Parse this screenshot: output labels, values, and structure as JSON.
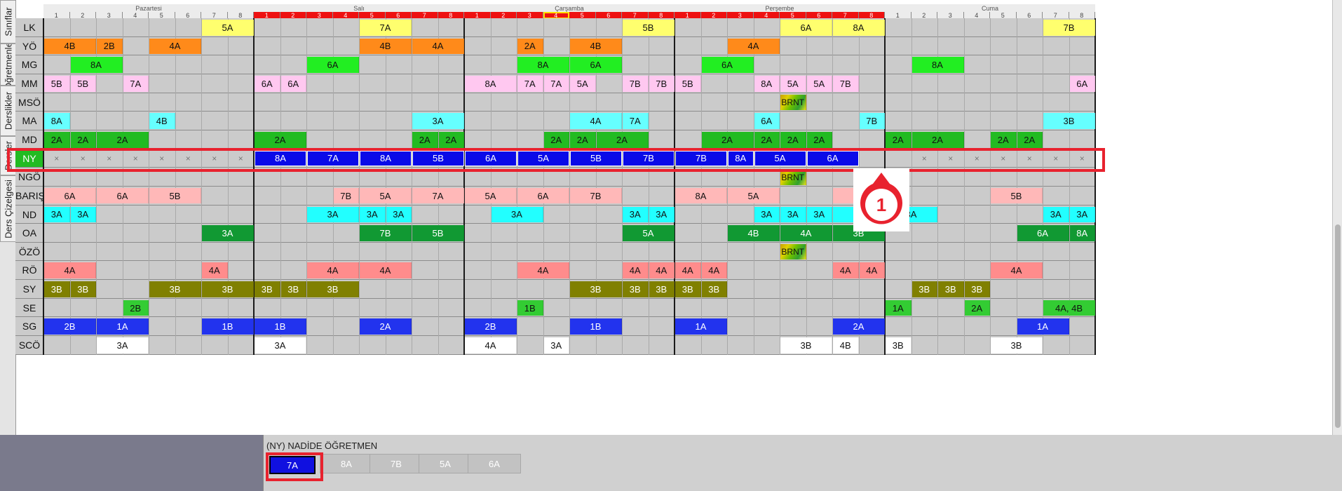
{
  "side_tabs": [
    "Sınıflar",
    "Öğretmenler",
    "Derslikler",
    "Dersler",
    "Ders Çizelgesi"
  ],
  "days": [
    "Pazartesi",
    "Salı",
    "Çarşamba",
    "Perşembe",
    "Cuma"
  ],
  "slot_numbers": [
    "1",
    "2",
    "3",
    "4",
    "5",
    "6",
    "7",
    "8"
  ],
  "conflict_color": "#ee1111",
  "conflict_days": [
    1,
    2,
    3
  ],
  "current_slot": {
    "day": 2,
    "slot": 3
  },
  "teachers": [
    "LK",
    "YÖ",
    "MG",
    "MM",
    "MSÖ",
    "MA",
    "MD",
    "NY",
    "NGÖ",
    "BARIŞ",
    "ND",
    "OA",
    "ÖZÖ",
    "RÖ",
    "SY",
    "SE",
    "SG",
    "SCÖ"
  ],
  "selected_teacher": "NY",
  "palette": {
    "LK": "#ffff6e",
    "YÖ": "#ff8a1a",
    "MG": "#22ee22",
    "MM": "#ffc8f0",
    "MA": "#66ffff",
    "MD": "#22bb22",
    "NY": "#0a0ae8",
    "BARIŞ": "#ffb8b8",
    "ND": "#22ffff",
    "OA": "#119933",
    "RÖ": "#ff8c8c",
    "SY": "#808000",
    "SE": "#33cc33",
    "SG": "#2233ee",
    "SCÖ": "#ffffff"
  },
  "lessons": [
    {
      "t": "LK",
      "d": 0,
      "s": 6,
      "w": 2,
      "label": "5A"
    },
    {
      "t": "LK",
      "d": 1,
      "s": 4,
      "w": 2,
      "label": "7A"
    },
    {
      "t": "LK",
      "d": 2,
      "s": 6,
      "w": 2,
      "label": "5B"
    },
    {
      "t": "LK",
      "d": 3,
      "s": 4,
      "w": 2,
      "label": "6A"
    },
    {
      "t": "LK",
      "d": 3,
      "s": 6,
      "w": 2,
      "label": "8A"
    },
    {
      "t": "LK",
      "d": 4,
      "s": 6,
      "w": 2,
      "label": "7B"
    },
    {
      "t": "YÖ",
      "d": 0,
      "s": 0,
      "w": 2,
      "label": "4B"
    },
    {
      "t": "YÖ",
      "d": 0,
      "s": 2,
      "w": 1,
      "label": "2B"
    },
    {
      "t": "YÖ",
      "d": 0,
      "s": 4,
      "w": 2,
      "label": "4A"
    },
    {
      "t": "YÖ",
      "d": 1,
      "s": 4,
      "w": 2,
      "label": "4B"
    },
    {
      "t": "YÖ",
      "d": 1,
      "s": 6,
      "w": 2,
      "label": "4A"
    },
    {
      "t": "YÖ",
      "d": 2,
      "s": 2,
      "w": 1,
      "label": "2A"
    },
    {
      "t": "YÖ",
      "d": 2,
      "s": 4,
      "w": 2,
      "label": "4B"
    },
    {
      "t": "YÖ",
      "d": 3,
      "s": 2,
      "w": 2,
      "label": "4A"
    },
    {
      "t": "MG",
      "d": 0,
      "s": 1,
      "w": 2,
      "label": "8A"
    },
    {
      "t": "MG",
      "d": 1,
      "s": 2,
      "w": 2,
      "label": "6A"
    },
    {
      "t": "MG",
      "d": 2,
      "s": 2,
      "w": 2,
      "label": "8A"
    },
    {
      "t": "MG",
      "d": 2,
      "s": 4,
      "w": 2,
      "label": "6A"
    },
    {
      "t": "MG",
      "d": 3,
      "s": 1,
      "w": 2,
      "label": "6A"
    },
    {
      "t": "MG",
      "d": 4,
      "s": 1,
      "w": 2,
      "label": "8A"
    },
    {
      "t": "MM",
      "d": 0,
      "s": 0,
      "w": 1,
      "label": "5B"
    },
    {
      "t": "MM",
      "d": 0,
      "s": 1,
      "w": 1,
      "label": "5B"
    },
    {
      "t": "MM",
      "d": 0,
      "s": 3,
      "w": 1,
      "label": "7A"
    },
    {
      "t": "MM",
      "d": 1,
      "s": 0,
      "w": 1,
      "label": "6A"
    },
    {
      "t": "MM",
      "d": 1,
      "s": 1,
      "w": 1,
      "label": "6A"
    },
    {
      "t": "MM",
      "d": 2,
      "s": 0,
      "w": 2,
      "label": "8A"
    },
    {
      "t": "MM",
      "d": 2,
      "s": 2,
      "w": 1,
      "label": "7A"
    },
    {
      "t": "MM",
      "d": 2,
      "s": 3,
      "w": 1,
      "label": "7A"
    },
    {
      "t": "MM",
      "d": 2,
      "s": 4,
      "w": 1,
      "label": "5A"
    },
    {
      "t": "MM",
      "d": 2,
      "s": 6,
      "w": 1,
      "label": "7B"
    },
    {
      "t": "MM",
      "d": 2,
      "s": 7,
      "w": 1,
      "label": "7B"
    },
    {
      "t": "MM",
      "d": 3,
      "s": 0,
      "w": 1,
      "label": "5B"
    },
    {
      "t": "MM",
      "d": 3,
      "s": 3,
      "w": 1,
      "label": "8A"
    },
    {
      "t": "MM",
      "d": 3,
      "s": 4,
      "w": 1,
      "label": "5A"
    },
    {
      "t": "MM",
      "d": 3,
      "s": 5,
      "w": 1,
      "label": "5A"
    },
    {
      "t": "MM",
      "d": 3,
      "s": 6,
      "w": 1,
      "label": "7B"
    },
    {
      "t": "MM",
      "d": 4,
      "s": 7,
      "w": 1,
      "label": "6A"
    },
    {
      "t": "MSÖ",
      "d": 3,
      "s": 4,
      "w": 1,
      "label": "BRNT",
      "brnt": true
    },
    {
      "t": "MA",
      "d": 0,
      "s": 0,
      "w": 1,
      "label": "8A"
    },
    {
      "t": "MA",
      "d": 0,
      "s": 4,
      "w": 1,
      "label": "4B"
    },
    {
      "t": "MA",
      "d": 1,
      "s": 6,
      "w": 2,
      "label": "3A"
    },
    {
      "t": "MA",
      "d": 2,
      "s": 4,
      "w": 2,
      "label": "4A"
    },
    {
      "t": "MA",
      "d": 2,
      "s": 6,
      "w": 1,
      "label": "7A"
    },
    {
      "t": "MA",
      "d": 3,
      "s": 3,
      "w": 1,
      "label": "6A"
    },
    {
      "t": "MA",
      "d": 3,
      "s": 7,
      "w": 1,
      "label": "7B"
    },
    {
      "t": "MA",
      "d": 4,
      "s": 6,
      "w": 2,
      "label": "3B"
    },
    {
      "t": "MD",
      "d": 0,
      "s": 0,
      "w": 1,
      "label": "2A"
    },
    {
      "t": "MD",
      "d": 0,
      "s": 1,
      "w": 1,
      "label": "2A"
    },
    {
      "t": "MD",
      "d": 0,
      "s": 2,
      "w": 2,
      "label": "2A"
    },
    {
      "t": "MD",
      "d": 1,
      "s": 0,
      "w": 2,
      "label": "2A"
    },
    {
      "t": "MD",
      "d": 1,
      "s": 6,
      "w": 1,
      "label": "2A"
    },
    {
      "t": "MD",
      "d": 1,
      "s": 7,
      "w": 1,
      "label": "2A"
    },
    {
      "t": "MD",
      "d": 2,
      "s": 3,
      "w": 1,
      "label": "2A"
    },
    {
      "t": "MD",
      "d": 2,
      "s": 4,
      "w": 1,
      "label": "2A"
    },
    {
      "t": "MD",
      "d": 2,
      "s": 5,
      "w": 2,
      "label": "2A"
    },
    {
      "t": "MD",
      "d": 3,
      "s": 1,
      "w": 2,
      "label": "2A"
    },
    {
      "t": "MD",
      "d": 3,
      "s": 3,
      "w": 1,
      "label": "2A"
    },
    {
      "t": "MD",
      "d": 3,
      "s": 4,
      "w": 1,
      "label": "2A"
    },
    {
      "t": "MD",
      "d": 3,
      "s": 5,
      "w": 1,
      "label": "2A"
    },
    {
      "t": "MD",
      "d": 4,
      "s": 0,
      "w": 1,
      "label": "2A"
    },
    {
      "t": "MD",
      "d": 4,
      "s": 1,
      "w": 2,
      "label": "2A"
    },
    {
      "t": "MD",
      "d": 4,
      "s": 4,
      "w": 1,
      "label": "2A"
    },
    {
      "t": "MD",
      "d": 4,
      "s": 5,
      "w": 1,
      "label": "2A"
    },
    {
      "t": "NY",
      "d": 1,
      "s": 0,
      "w": 2,
      "label": "8A"
    },
    {
      "t": "NY",
      "d": 1,
      "s": 2,
      "w": 2,
      "label": "7A"
    },
    {
      "t": "NY",
      "d": 1,
      "s": 4,
      "w": 2,
      "label": "8A"
    },
    {
      "t": "NY",
      "d": 1,
      "s": 6,
      "w": 2,
      "label": "5B"
    },
    {
      "t": "NY",
      "d": 2,
      "s": 0,
      "w": 2,
      "label": "6A"
    },
    {
      "t": "NY",
      "d": 2,
      "s": 2,
      "w": 2,
      "label": "5A"
    },
    {
      "t": "NY",
      "d": 2,
      "s": 4,
      "w": 2,
      "label": "5B"
    },
    {
      "t": "NY",
      "d": 2,
      "s": 6,
      "w": 2,
      "label": "7B"
    },
    {
      "t": "NY",
      "d": 3,
      "s": 0,
      "w": 2,
      "label": "7B"
    },
    {
      "t": "NY",
      "d": 3,
      "s": 2,
      "w": 1,
      "label": "8A"
    },
    {
      "t": "NY",
      "d": 3,
      "s": 3,
      "w": 2,
      "label": "5A"
    },
    {
      "t": "NY",
      "d": 3,
      "s": 5,
      "w": 2,
      "label": "6A"
    },
    {
      "t": "NGÖ",
      "d": 3,
      "s": 4,
      "w": 1,
      "label": "BRNT",
      "brnt": true
    },
    {
      "t": "BARIŞ",
      "d": 0,
      "s": 0,
      "w": 2,
      "label": "6A"
    },
    {
      "t": "BARIŞ",
      "d": 0,
      "s": 2,
      "w": 2,
      "label": "6A"
    },
    {
      "t": "BARIŞ",
      "d": 0,
      "s": 4,
      "w": 2,
      "label": "5B"
    },
    {
      "t": "BARIŞ",
      "d": 1,
      "s": 3,
      "w": 1,
      "label": "7B"
    },
    {
      "t": "BARIŞ",
      "d": 1,
      "s": 4,
      "w": 2,
      "label": "5A"
    },
    {
      "t": "BARIŞ",
      "d": 1,
      "s": 6,
      "w": 2,
      "label": "7A"
    },
    {
      "t": "BARIŞ",
      "d": 2,
      "s": 0,
      "w": 2,
      "label": "5A"
    },
    {
      "t": "BARIŞ",
      "d": 2,
      "s": 2,
      "w": 2,
      "label": "6A"
    },
    {
      "t": "BARIŞ",
      "d": 2,
      "s": 4,
      "w": 2,
      "label": "7B"
    },
    {
      "t": "BARIŞ",
      "d": 3,
      "s": 0,
      "w": 2,
      "label": "8A"
    },
    {
      "t": "BARIŞ",
      "d": 3,
      "s": 2,
      "w": 2,
      "label": "5A"
    },
    {
      "t": "BARIŞ",
      "d": 3,
      "s": 6,
      "w": 2,
      "label": "5B"
    },
    {
      "t": "BARIŞ",
      "d": 4,
      "s": 4,
      "w": 2,
      "label": "5B"
    },
    {
      "t": "ND",
      "d": 0,
      "s": 0,
      "w": 1,
      "label": "3A"
    },
    {
      "t": "ND",
      "d": 0,
      "s": 1,
      "w": 1,
      "label": "3A"
    },
    {
      "t": "ND",
      "d": 1,
      "s": 2,
      "w": 2,
      "label": "3A"
    },
    {
      "t": "ND",
      "d": 1,
      "s": 4,
      "w": 1,
      "label": "3A"
    },
    {
      "t": "ND",
      "d": 1,
      "s": 5,
      "w": 1,
      "label": "3A"
    },
    {
      "t": "ND",
      "d": 2,
      "s": 1,
      "w": 2,
      "label": "3A"
    },
    {
      "t": "ND",
      "d": 2,
      "s": 6,
      "w": 1,
      "label": "3A"
    },
    {
      "t": "ND",
      "d": 2,
      "s": 7,
      "w": 1,
      "label": "3A"
    },
    {
      "t": "ND",
      "d": 3,
      "s": 3,
      "w": 1,
      "label": "3A"
    },
    {
      "t": "ND",
      "d": 3,
      "s": 4,
      "w": 1,
      "label": "3A"
    },
    {
      "t": "ND",
      "d": 3,
      "s": 5,
      "w": 1,
      "label": "3A"
    },
    {
      "t": "ND",
      "d": 3,
      "s": 6,
      "w": 2,
      "label": "3A"
    },
    {
      "t": "ND",
      "d": 4,
      "s": 0,
      "w": 2,
      "label": "3A"
    },
    {
      "t": "ND",
      "d": 4,
      "s": 6,
      "w": 1,
      "label": "3A"
    },
    {
      "t": "ND",
      "d": 4,
      "s": 7,
      "w": 1,
      "label": "3A"
    },
    {
      "t": "OA",
      "d": 0,
      "s": 6,
      "w": 2,
      "label": "3A"
    },
    {
      "t": "OA",
      "d": 1,
      "s": 4,
      "w": 2,
      "label": "7B"
    },
    {
      "t": "OA",
      "d": 1,
      "s": 6,
      "w": 2,
      "label": "5B"
    },
    {
      "t": "OA",
      "d": 2,
      "s": 6,
      "w": 2,
      "label": "5A"
    },
    {
      "t": "OA",
      "d": 3,
      "s": 2,
      "w": 2,
      "label": "4B"
    },
    {
      "t": "OA",
      "d": 3,
      "s": 4,
      "w": 2,
      "label": "4A"
    },
    {
      "t": "OA",
      "d": 3,
      "s": 6,
      "w": 2,
      "label": "3B"
    },
    {
      "t": "OA",
      "d": 4,
      "s": 5,
      "w": 2,
      "label": "6A"
    },
    {
      "t": "OA",
      "d": 4,
      "s": 7,
      "w": 1,
      "label": "8A"
    },
    {
      "t": "ÖZÖ",
      "d": 3,
      "s": 4,
      "w": 1,
      "label": "BRNT",
      "brnt": true
    },
    {
      "t": "RÖ",
      "d": 0,
      "s": 0,
      "w": 2,
      "label": "4A"
    },
    {
      "t": "RÖ",
      "d": 0,
      "s": 6,
      "w": 1,
      "label": "4A"
    },
    {
      "t": "RÖ",
      "d": 1,
      "s": 2,
      "w": 2,
      "label": "4A"
    },
    {
      "t": "RÖ",
      "d": 1,
      "s": 4,
      "w": 2,
      "label": "4A"
    },
    {
      "t": "RÖ",
      "d": 2,
      "s": 2,
      "w": 2,
      "label": "4A"
    },
    {
      "t": "RÖ",
      "d": 2,
      "s": 6,
      "w": 1,
      "label": "4A"
    },
    {
      "t": "RÖ",
      "d": 2,
      "s": 7,
      "w": 1,
      "label": "4A"
    },
    {
      "t": "RÖ",
      "d": 3,
      "s": 0,
      "w": 1,
      "label": "4A"
    },
    {
      "t": "RÖ",
      "d": 3,
      "s": 1,
      "w": 1,
      "label": "4A"
    },
    {
      "t": "RÖ",
      "d": 3,
      "s": 6,
      "w": 1,
      "label": "4A"
    },
    {
      "t": "RÖ",
      "d": 3,
      "s": 7,
      "w": 1,
      "label": "4A"
    },
    {
      "t": "RÖ",
      "d": 4,
      "s": 4,
      "w": 2,
      "label": "4A"
    },
    {
      "t": "SY",
      "d": 0,
      "s": 0,
      "w": 1,
      "label": "3B"
    },
    {
      "t": "SY",
      "d": 0,
      "s": 1,
      "w": 1,
      "label": "3B"
    },
    {
      "t": "SY",
      "d": 0,
      "s": 4,
      "w": 2,
      "label": "3B"
    },
    {
      "t": "SY",
      "d": 0,
      "s": 6,
      "w": 2,
      "label": "3B"
    },
    {
      "t": "SY",
      "d": 1,
      "s": 0,
      "w": 1,
      "label": "3B"
    },
    {
      "t": "SY",
      "d": 1,
      "s": 1,
      "w": 1,
      "label": "3B"
    },
    {
      "t": "SY",
      "d": 1,
      "s": 2,
      "w": 2,
      "label": "3B"
    },
    {
      "t": "SY",
      "d": 2,
      "s": 4,
      "w": 2,
      "label": "3B"
    },
    {
      "t": "SY",
      "d": 2,
      "s": 6,
      "w": 1,
      "label": "3B"
    },
    {
      "t": "SY",
      "d": 2,
      "s": 7,
      "w": 1,
      "label": "3B"
    },
    {
      "t": "SY",
      "d": 3,
      "s": 0,
      "w": 1,
      "label": "3B"
    },
    {
      "t": "SY",
      "d": 3,
      "s": 1,
      "w": 1,
      "label": "3B"
    },
    {
      "t": "SY",
      "d": 4,
      "s": 1,
      "w": 1,
      "label": "3B"
    },
    {
      "t": "SY",
      "d": 4,
      "s": 2,
      "w": 1,
      "label": "3B"
    },
    {
      "t": "SY",
      "d": 4,
      "s": 3,
      "w": 1,
      "label": "3B"
    },
    {
      "t": "SE",
      "d": 0,
      "s": 3,
      "w": 1,
      "label": "2B"
    },
    {
      "t": "SE",
      "d": 2,
      "s": 2,
      "w": 1,
      "label": "1B"
    },
    {
      "t": "SE",
      "d": 4,
      "s": 0,
      "w": 1,
      "label": "1A"
    },
    {
      "t": "SE",
      "d": 4,
      "s": 3,
      "w": 1,
      "label": "2A"
    },
    {
      "t": "SE",
      "d": 4,
      "s": 6,
      "w": 2,
      "label": "4A, 4B"
    },
    {
      "t": "SG",
      "d": 0,
      "s": 0,
      "w": 2,
      "label": "2B"
    },
    {
      "t": "SG",
      "d": 0,
      "s": 2,
      "w": 2,
      "label": "1A"
    },
    {
      "t": "SG",
      "d": 0,
      "s": 6,
      "w": 2,
      "label": "1B"
    },
    {
      "t": "SG",
      "d": 1,
      "s": 0,
      "w": 2,
      "label": "1B"
    },
    {
      "t": "SG",
      "d": 1,
      "s": 4,
      "w": 2,
      "label": "2A"
    },
    {
      "t": "SG",
      "d": 2,
      "s": 0,
      "w": 2,
      "label": "2B"
    },
    {
      "t": "SG",
      "d": 2,
      "s": 4,
      "w": 2,
      "label": "1B"
    },
    {
      "t": "SG",
      "d": 3,
      "s": 0,
      "w": 2,
      "label": "1A"
    },
    {
      "t": "SG",
      "d": 3,
      "s": 6,
      "w": 2,
      "label": "2A"
    },
    {
      "t": "SG",
      "d": 4,
      "s": 5,
      "w": 2,
      "label": "1A"
    },
    {
      "t": "SCÖ",
      "d": 0,
      "s": 2,
      "w": 2,
      "label": "3A"
    },
    {
      "t": "SCÖ",
      "d": 1,
      "s": 0,
      "w": 2,
      "label": "3A"
    },
    {
      "t": "SCÖ",
      "d": 2,
      "s": 0,
      "w": 2,
      "label": "4A"
    },
    {
      "t": "SCÖ",
      "d": 2,
      "s": 3,
      "w": 1,
      "label": "3A"
    },
    {
      "t": "SCÖ",
      "d": 3,
      "s": 4,
      "w": 2,
      "label": "3B"
    },
    {
      "t": "SCÖ",
      "d": 3,
      "s": 6,
      "w": 1,
      "label": "4B"
    },
    {
      "t": "SCÖ",
      "d": 4,
      "s": 0,
      "w": 1,
      "label": "3B"
    },
    {
      "t": "SCÖ",
      "d": 4,
      "s": 4,
      "w": 2,
      "label": "3B"
    }
  ],
  "ny_unavailable": [
    {
      "d": 0,
      "s": 0
    },
    {
      "d": 0,
      "s": 1
    },
    {
      "d": 0,
      "s": 2
    },
    {
      "d": 0,
      "s": 3
    },
    {
      "d": 0,
      "s": 4
    },
    {
      "d": 0,
      "s": 5
    },
    {
      "d": 0,
      "s": 6
    },
    {
      "d": 0,
      "s": 7
    },
    {
      "d": 4,
      "s": 1
    },
    {
      "d": 4,
      "s": 2
    },
    {
      "d": 4,
      "s": 3
    },
    {
      "d": 4,
      "s": 4
    },
    {
      "d": 4,
      "s": 5
    },
    {
      "d": 4,
      "s": 6
    },
    {
      "d": 4,
      "s": 7
    }
  ],
  "unavailable_glyph": "×",
  "callout_number": "1",
  "bottom_panel": {
    "title": "(NY) NADİDE ÖĞRETMEN",
    "chips": [
      {
        "label": "7A",
        "active": true
      },
      {
        "label": "8A",
        "active": false
      },
      {
        "label": "7B",
        "active": false
      },
      {
        "label": "5A",
        "active": false
      },
      {
        "label": "6A",
        "active": false
      }
    ]
  }
}
